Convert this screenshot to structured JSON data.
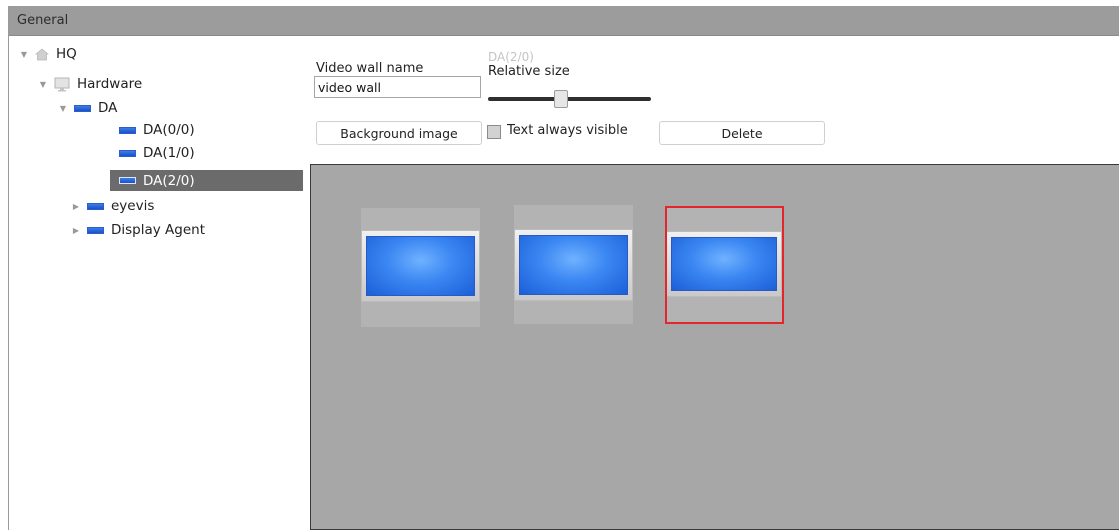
{
  "panel": {
    "title": "General"
  },
  "tree": {
    "items": [
      {
        "label": "HQ",
        "icon": "home-icon",
        "expanded": true
      },
      {
        "label": "Hardware",
        "icon": "monitor-icon",
        "expanded": true
      },
      {
        "label": "DA",
        "icon": "display-icon",
        "expanded": true
      },
      {
        "label": "DA(0/0)",
        "icon": "display-icon"
      },
      {
        "label": "DA(1/0)",
        "icon": "display-icon"
      },
      {
        "label": "DA(2/0)",
        "icon": "display-icon",
        "selected": true
      },
      {
        "label": "eyevis",
        "icon": "display-icon",
        "expanded": false
      },
      {
        "label": "Display Agent",
        "icon": "display-icon",
        "expanded": false
      }
    ]
  },
  "form": {
    "video_wall_name_label": "Video wall name",
    "video_wall_name_value": "video wall",
    "selected_display_caption": "DA(2/0)",
    "relative_size_label": "Relative size",
    "relative_size_fraction": 0.45,
    "background_image_button": "Background image",
    "text_always_visible_label": "Text always visible",
    "text_always_visible_checked": false,
    "delete_button": "Delete"
  },
  "wall": {
    "displays": [
      {
        "id": "DA(0/0)",
        "selected": false
      },
      {
        "id": "DA(1/0)",
        "selected": false
      },
      {
        "id": "DA(2/0)",
        "selected": true
      }
    ]
  },
  "colors": {
    "header_bg": "#9c9c9c",
    "selection_bg": "#6b6b6b",
    "canvas_bg": "#a7a7a7",
    "screen_blue": "#3a86f2",
    "selected_outline": "#e2262a"
  }
}
